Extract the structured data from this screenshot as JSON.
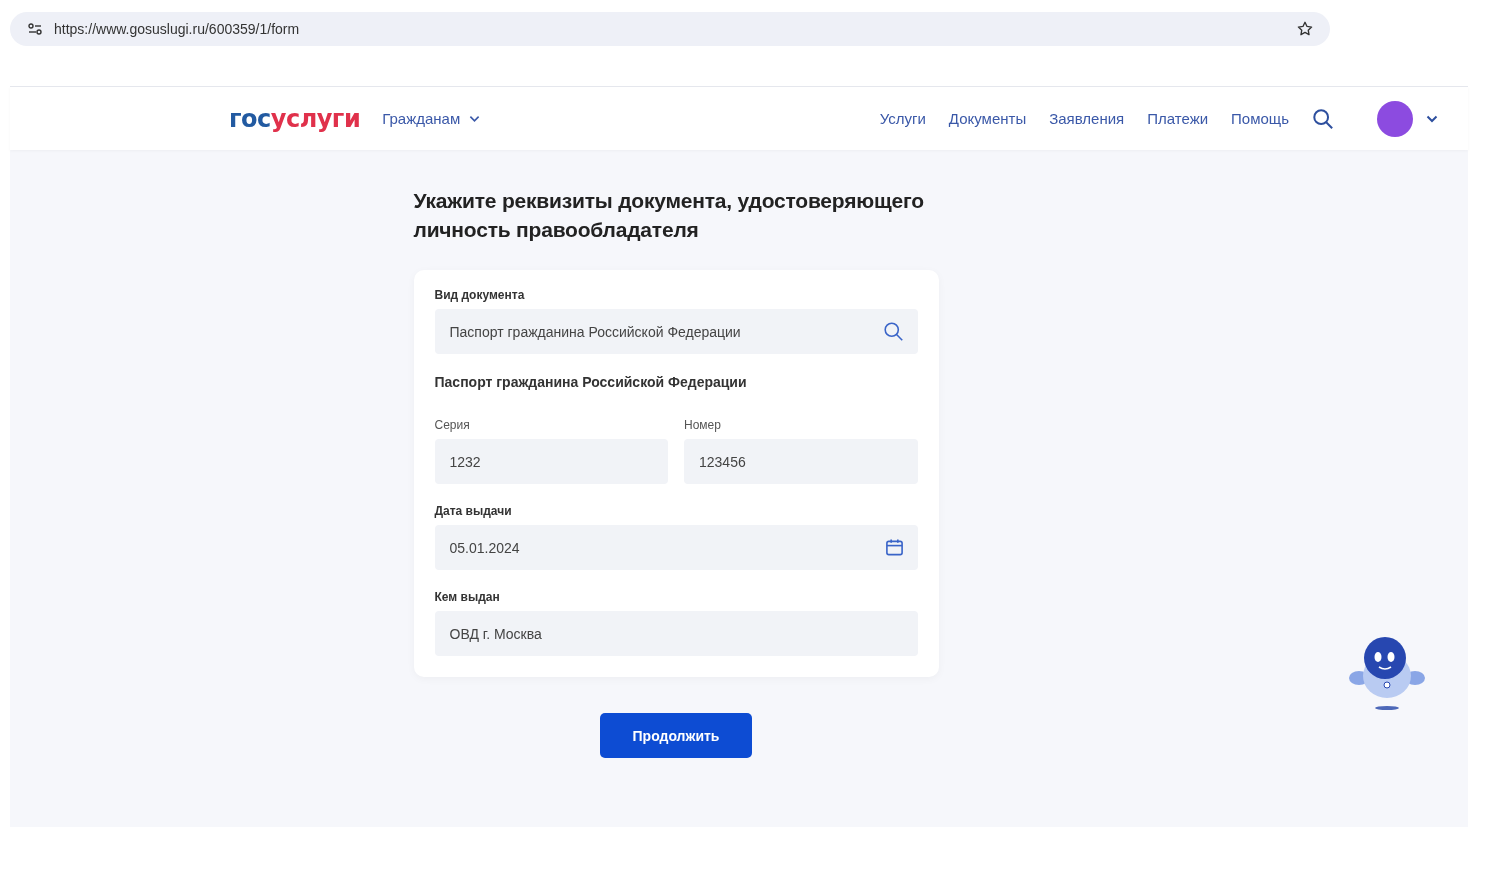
{
  "browser": {
    "url": "https://www.gosuslugi.ru/600359/1/form"
  },
  "header": {
    "logo": {
      "part_1": "гос",
      "part_2": "услуги"
    },
    "audience_menu": "Гражданам",
    "nav": [
      "Услуги",
      "Документы",
      "Заявления",
      "Платежи",
      "Помощь"
    ]
  },
  "form": {
    "title": "Укажите реквизиты документа, удостоверяющего личность правообладателя",
    "document_type": {
      "label": "Вид документа",
      "value": "Паспорт гражданина Российской Федерации"
    },
    "section_title": "Паспорт гражданина Российской Федерации",
    "series": {
      "label": "Серия",
      "value": "1232"
    },
    "number": {
      "label": "Номер",
      "value": "123456"
    },
    "issue_date": {
      "label": "Дата выдачи",
      "value": "05.01.2024"
    },
    "issued_by": {
      "label": "Кем выдан",
      "value": "ОВД г. Москва"
    },
    "submit": "Продолжить"
  }
}
